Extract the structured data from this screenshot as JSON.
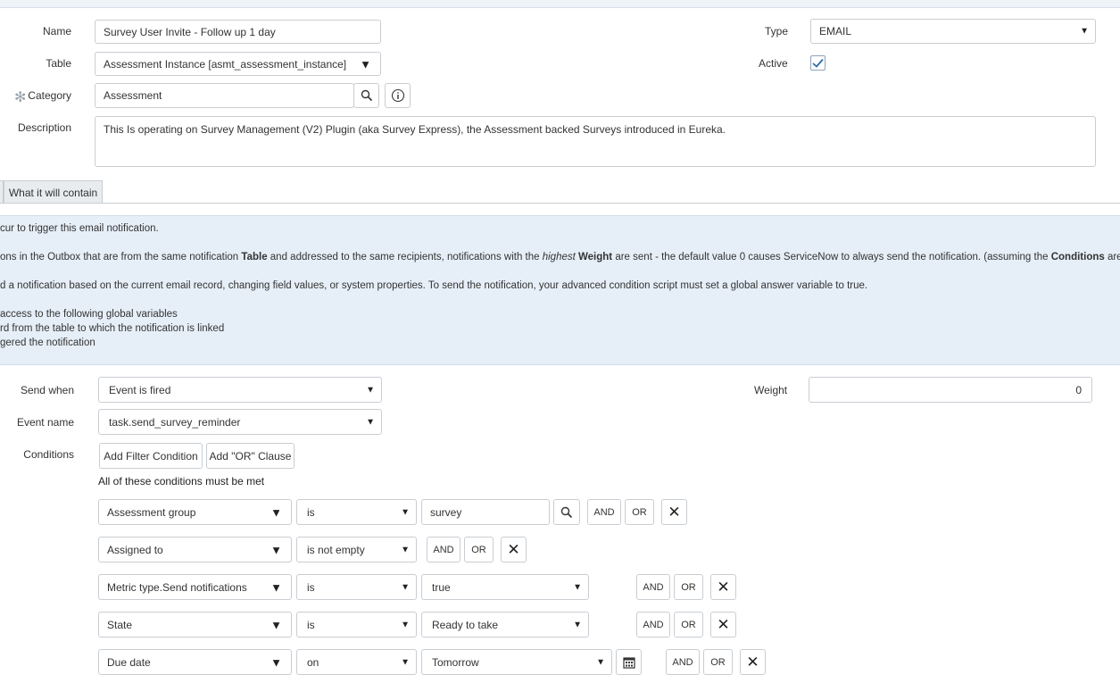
{
  "form": {
    "name_label": "Name",
    "name_value": "Survey User Invite - Follow up 1 day",
    "table_label": "Table",
    "table_value": "Assessment Instance [asmt_assessment_instance]",
    "category_label": "Category",
    "category_value": "Assessment",
    "description_label": "Description",
    "description_value": "This Is operating on Survey Management (V2) Plugin (aka Survey Express), the Assessment backed Surveys introduced in Eureka.",
    "type_label": "Type",
    "type_value": "EMAIL",
    "active_label": "Active",
    "active_checked": true
  },
  "tabs": [
    {
      "label": "What it will contain"
    }
  ],
  "info": {
    "line1": "cur to trigger this email notification.",
    "line2_a": "ons in the Outbox that are from the same notification ",
    "line2_b": "Table",
    "line2_c": " and addressed to the same recipients, notifications with the ",
    "line2_d": "highest",
    "line2_e": "Weight",
    "line2_f": " are sent - the default value 0 causes ServiceNow to always send the notification. (assuming the ",
    "line2_g": "Conditions",
    "line2_h": " are met)",
    "line3": "d a notification based on the current email record, changing field values, or system properties. To send the notification, your advanced condition script must set a global answer variable to true.",
    "line4": " access to the following global variables",
    "line5": "rd from the table to which the notification is linked",
    "line6": "gered the notification"
  },
  "when": {
    "send_when_label": "Send when",
    "send_when_value": "Event is fired",
    "event_name_label": "Event name",
    "event_name_value": "task.send_survey_reminder",
    "weight_label": "Weight",
    "weight_value": "0",
    "conditions_label": "Conditions",
    "add_filter_label": "Add Filter Condition",
    "add_or_label": "Add \"OR\" Clause",
    "all_met_text": "All of these conditions must be met"
  },
  "conditions": [
    {
      "field": "Assessment group",
      "operator": "is",
      "value": "survey"
    },
    {
      "field": "Assigned to",
      "operator": "is not empty",
      "value": ""
    },
    {
      "field": "Metric type.Send notifications",
      "operator": "is",
      "value": "true"
    },
    {
      "field": "State",
      "operator": "is",
      "value": "Ready to take"
    },
    {
      "field": "Due date",
      "operator": "on",
      "value": "Tomorrow"
    }
  ],
  "buttons": {
    "and": "AND",
    "or": "OR"
  },
  "colors": {
    "accent": "#2e6da4",
    "info_bg": "#e6eff8"
  }
}
